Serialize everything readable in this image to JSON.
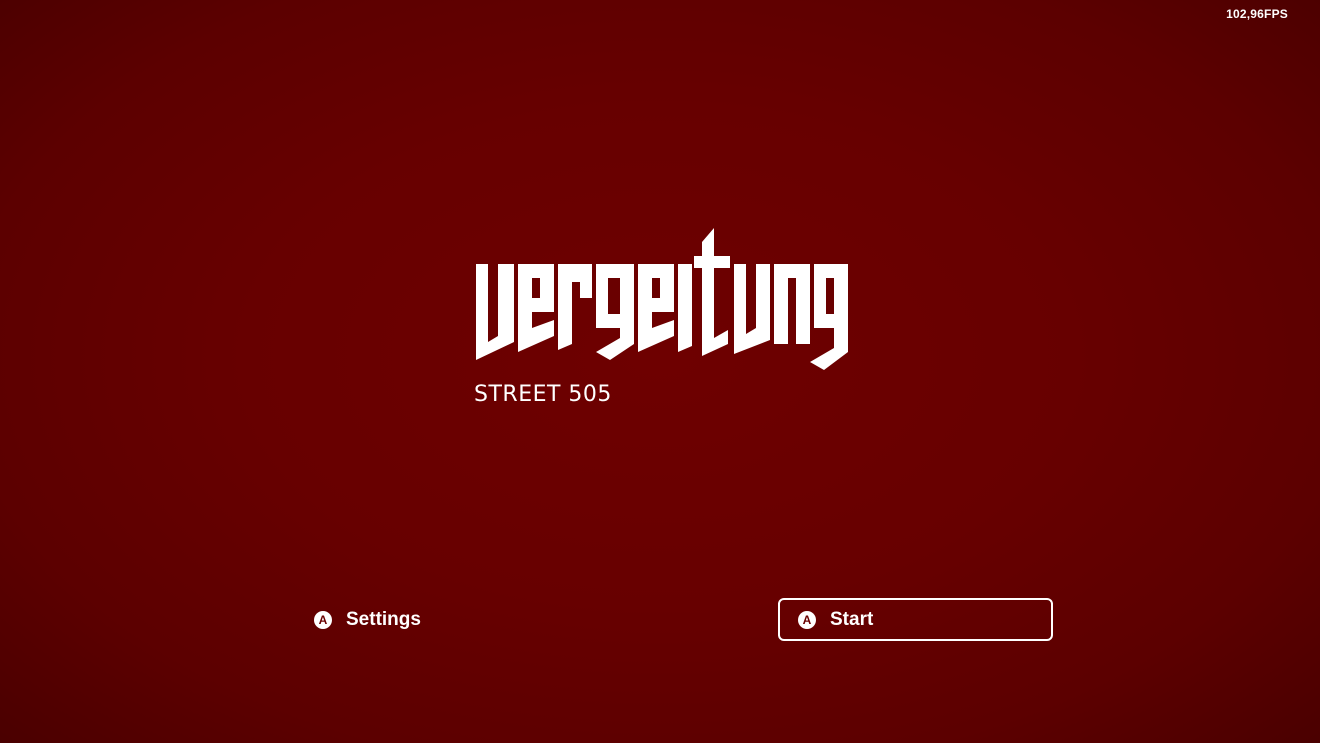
{
  "hud": {
    "fps": "102,96FPS"
  },
  "title": {
    "logo_text": "vergeltung",
    "subtitle": "STREET 505"
  },
  "menu": {
    "button_glyph": "A",
    "settings_label": "Settings",
    "start_label": "Start",
    "selected": "Start"
  },
  "colors": {
    "background": "#6a0000",
    "text": "#ffffff",
    "selection_border": "#ffffff"
  },
  "icons": {
    "button_prompt": "a-button-icon"
  }
}
